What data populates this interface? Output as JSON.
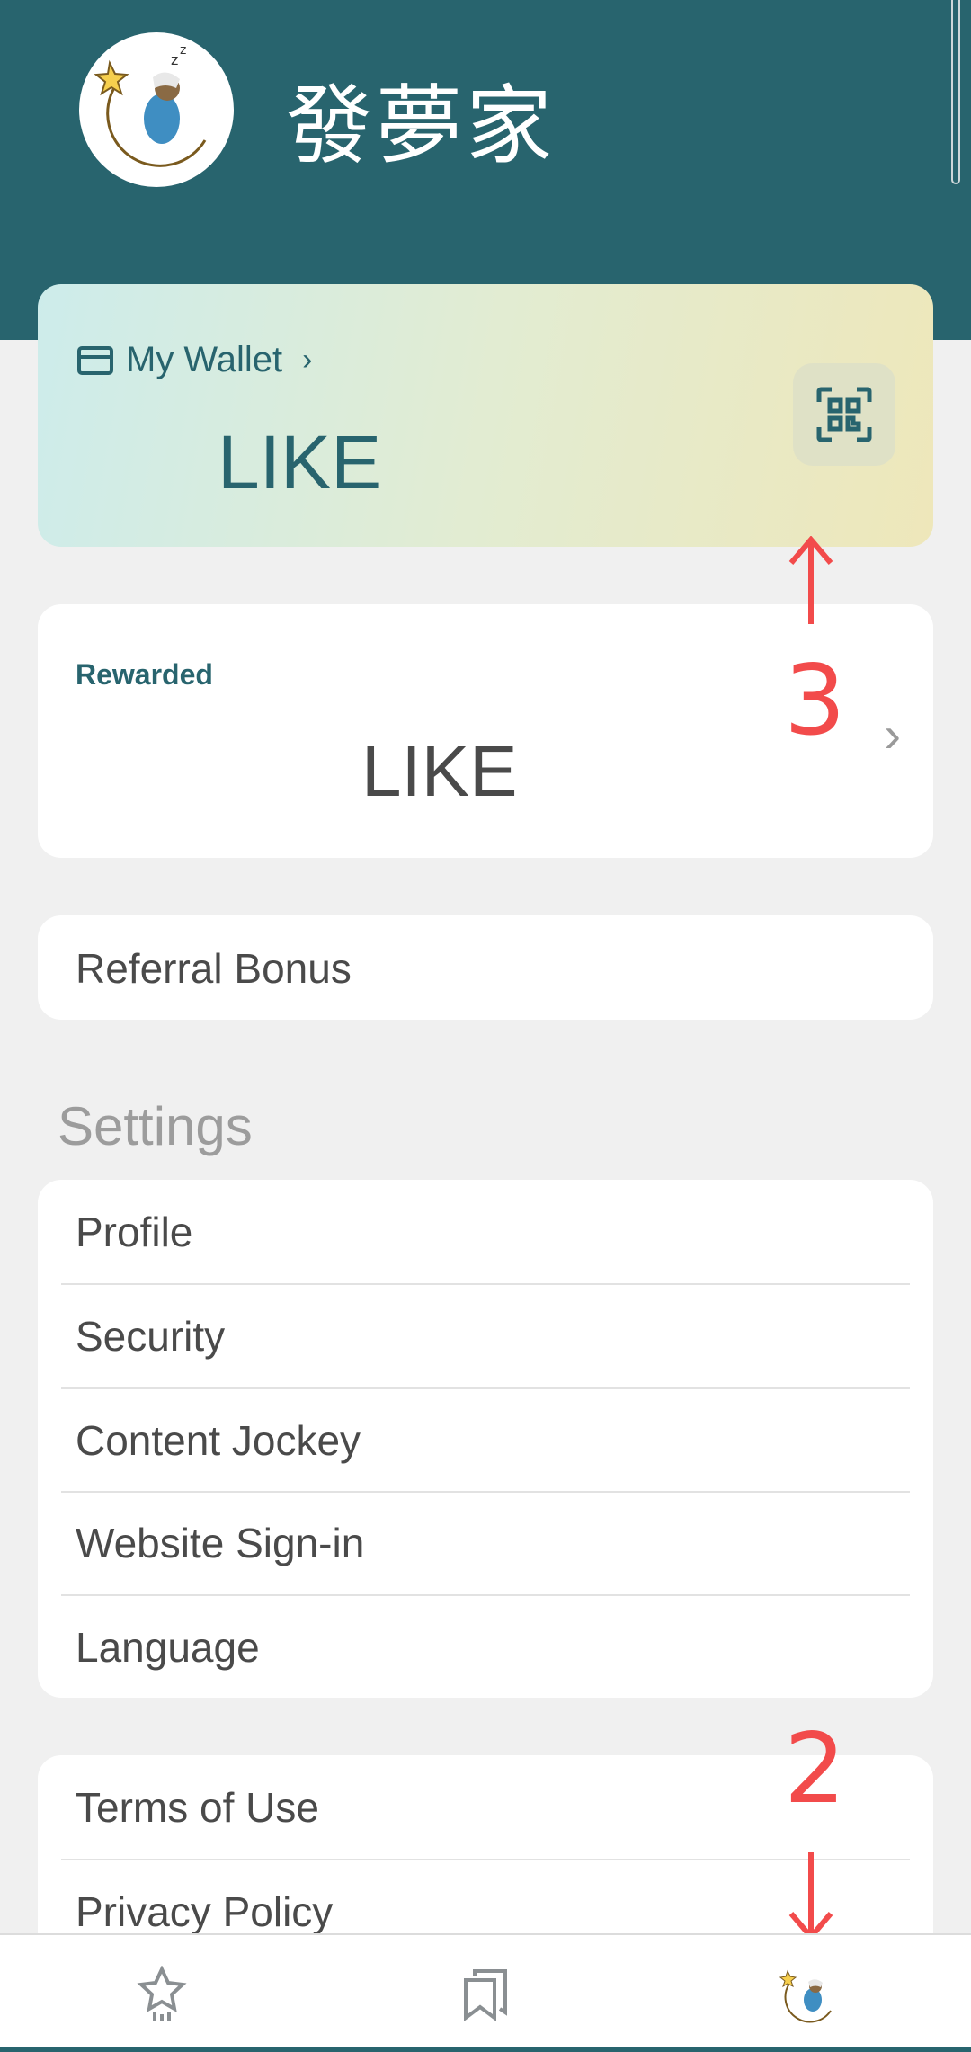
{
  "header": {
    "username": "發夢家",
    "avatar_icon": "sleeping-moon-avatar-icon"
  },
  "wallet": {
    "link_label": "My Wallet",
    "amount_unit": "LIKE",
    "qr_icon": "qr-scan-icon"
  },
  "rewarded": {
    "label": "Rewarded",
    "amount_unit": "LIKE"
  },
  "referral": {
    "label": "Referral Bonus"
  },
  "settings": {
    "title": "Settings",
    "items": [
      {
        "label": "Profile"
      },
      {
        "label": "Security"
      },
      {
        "label": "Content Jockey"
      },
      {
        "label": "Website Sign-in"
      },
      {
        "label": "Language"
      }
    ]
  },
  "legal": {
    "items": [
      {
        "label": "Terms of Use"
      },
      {
        "label": "Privacy Policy"
      }
    ]
  },
  "bottom_nav": {
    "items": [
      {
        "icon": "star-rocket-icon"
      },
      {
        "icon": "bookmarks-icon"
      },
      {
        "icon": "avatar-icon"
      }
    ]
  },
  "annotations": {
    "marker_3": "3",
    "marker_2": "2"
  },
  "colors": {
    "brand": "#28646e",
    "annotation": "#f24b4b"
  }
}
